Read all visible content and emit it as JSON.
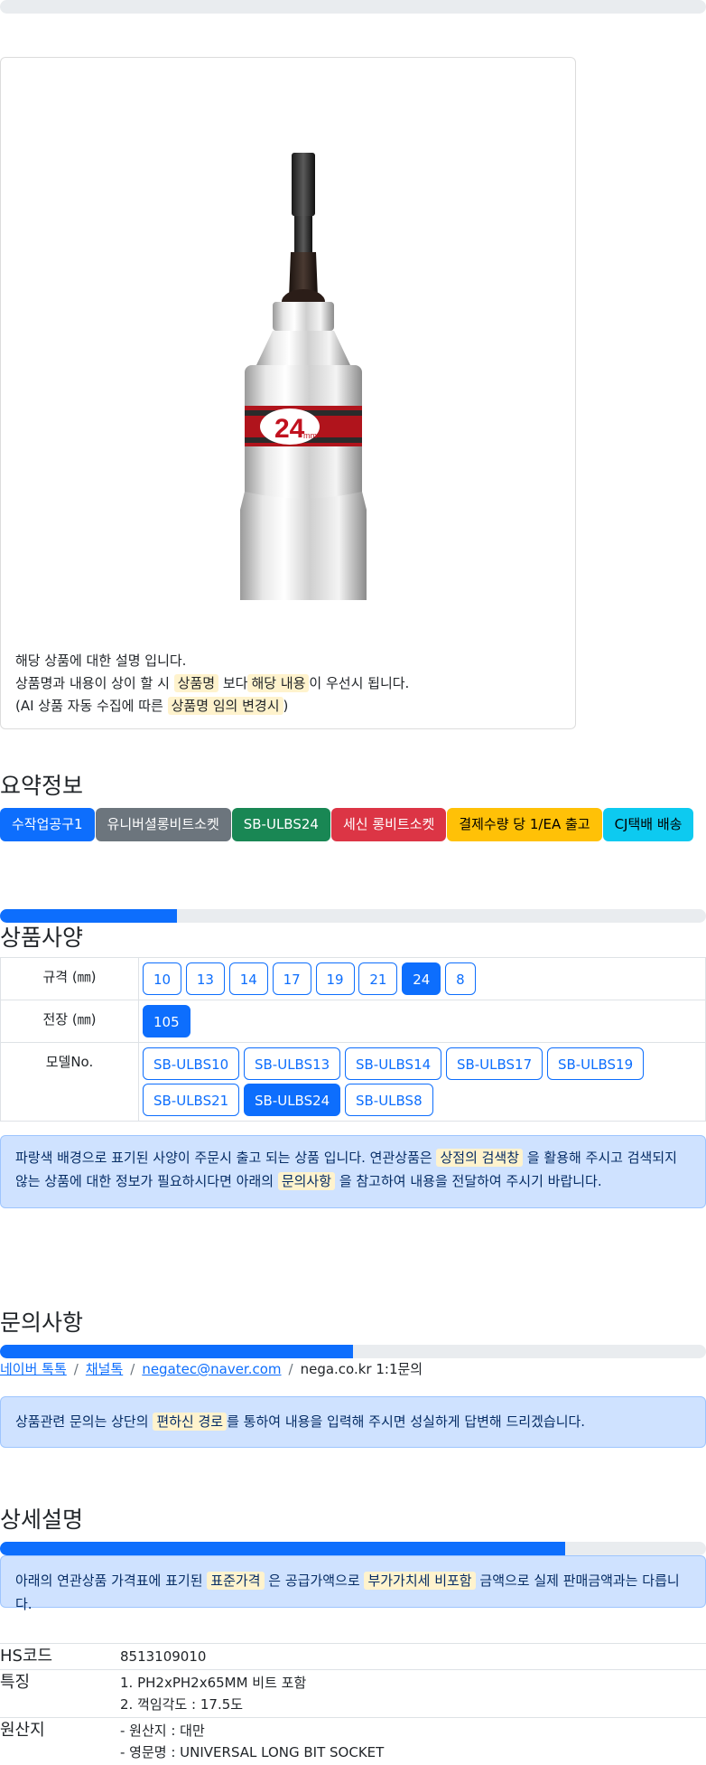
{
  "image_card": {
    "socket_size_label": "24",
    "socket_unit": "mm",
    "note_line1": "해당 상품에 대한 설명 입니다.",
    "note_line2_a": "상품명과 내용이 상이 할 시",
    "note_line2_hl1": "상품명",
    "note_line2_b": "보다",
    "note_line2_hl2": "해당 내용",
    "note_line2_c": "이 우선시 됩니다.",
    "note_line3_a": "(AI 상품 자동 수집에 따른",
    "note_line3_hl": "상품명 임의 변경시",
    "note_line3_b": ")"
  },
  "summary": {
    "title": "요약정보",
    "badges": [
      {
        "label": "수작업공구1",
        "color": "#0d6efd",
        "text_color": "#ffffff"
      },
      {
        "label": "유니버셜롱비트소켓",
        "color": "#6c757d",
        "text_color": "#ffffff"
      },
      {
        "label": "SB-ULBS24",
        "color": "#198754",
        "text_color": "#ffffff"
      },
      {
        "label": "세신 롱비트소켓",
        "color": "#dc3545",
        "text_color": "#ffffff"
      },
      {
        "label": "결제수량 당 1/EA 출고",
        "color": "#ffc107",
        "text_color": "#000000"
      },
      {
        "label": "CJ택배 배송",
        "color": "#0dcaf0",
        "text_color": "#000000"
      }
    ]
  },
  "spec": {
    "progress": 0.25,
    "title": "상품사양",
    "rows": [
      {
        "label": "규격 (㎜)",
        "options": [
          "10",
          "13",
          "14",
          "17",
          "19",
          "21",
          "24",
          "8"
        ],
        "selected": "24"
      },
      {
        "label": "전장 (㎜)",
        "options": [
          "105"
        ],
        "selected": "105"
      },
      {
        "label": "모델No.",
        "options": [
          "SB-ULBS10",
          "SB-ULBS13",
          "SB-ULBS14",
          "SB-ULBS17",
          "SB-ULBS19",
          "SB-ULBS21",
          "SB-ULBS24",
          "SB-ULBS8"
        ],
        "selected": "SB-ULBS24"
      }
    ],
    "notice_a": "파랑색 배경으로 표기된 사양이 주문시 출고 되는 상품 입니다. 연관상품은",
    "notice_hl1": "상점의 검색창",
    "notice_b": "을 활용해 주시고 검색되지 않는 상품에 대한 정보가 필요하시다면 아래의",
    "notice_hl2": "문의사항",
    "notice_c": "을 참고하여 내용을 전달하여 주시기 바랍니다."
  },
  "inquiry": {
    "title": "문의사항",
    "progress": 0.5,
    "link1": "네이버 톡톡",
    "link2": "채널톡",
    "link3": "negatec@naver.com",
    "sep": "/",
    "tail": "nega.co.kr 1:1문의",
    "notice_a": "상품관련 문의는 상단의",
    "notice_hl": "편하신 경로",
    "notice_b": "를 통하여 내용을 입력해 주시면 성실하게 답변해 드리겠습니다."
  },
  "detail": {
    "title": "상세설명",
    "progress": 0.8,
    "notice_a": "아래의 연관상품 가격표에 표기된",
    "notice_hl1": "표준가격",
    "notice_b": "은 공급가액으로",
    "notice_hl2": "부가가치세 비포함",
    "notice_c": "금액으로 실제 판매금액과는 다릅니다.",
    "rows": [
      {
        "key": "HS코드",
        "lines": [
          "8513109010"
        ]
      },
      {
        "key": "특징",
        "lines": [
          "1. PH2xPH2x65MM 비트 포함",
          "2. 꺽임각도 : 17.5도"
        ]
      },
      {
        "key": "원산지",
        "lines": [
          "- 원산지 : 대만",
          "- 영문명 : UNIVERSAL LONG BIT SOCKET"
        ]
      }
    ]
  }
}
